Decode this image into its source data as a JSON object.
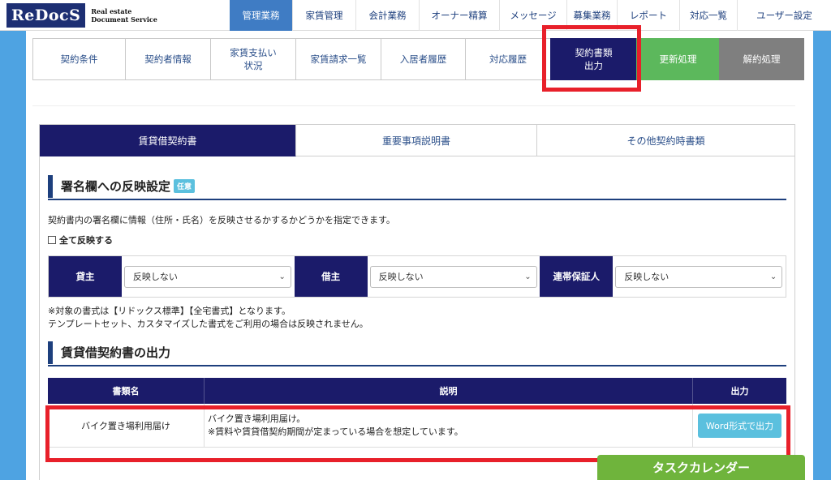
{
  "logo": {
    "main_prefix": "Re",
    "main_suffix": "DocS",
    "sub_line1": "Real estate",
    "sub_line2": "Document Service"
  },
  "nav": [
    "管理業務",
    "家賃管理",
    "会計業務",
    "オーナー精算",
    "メッセージ",
    "募集業務",
    "レポート",
    "対応一覧",
    "ユーザー設定"
  ],
  "subtabs": [
    {
      "label": "契約条件"
    },
    {
      "label": "契約者情報"
    },
    {
      "label": "家賃支払い\n状況"
    },
    {
      "label": "家賃請求一覧"
    },
    {
      "label": "入居者履歴"
    },
    {
      "label": "対応履歴"
    },
    {
      "label": "契約書類\n出力"
    },
    {
      "label": "更新処理"
    },
    {
      "label": "解約処理"
    }
  ],
  "doctabs": [
    "賃貸借契約書",
    "重要事項説明書",
    "その他契約時書類"
  ],
  "sign_section": {
    "title": "署名欄への反映設定",
    "badge": "任意",
    "description": "契約書内の署名欄に情報（住所・氏名）を反映させるかするかどうかを指定できます。",
    "all_reflect": "全て反映する",
    "parties": [
      {
        "label": "貸主",
        "value": "反映しない"
      },
      {
        "label": "借主",
        "value": "反映しない"
      },
      {
        "label": "連帯保証人",
        "value": "反映しない"
      }
    ],
    "note1": "※対象の書式は【リドックス標準】【全宅書式】となります。",
    "note2": "テンプレートセット、カスタマイズした書式をご利用の場合は反映されません。"
  },
  "output_section": {
    "title": "賃貸借契約書の出力",
    "headers": [
      "書類名",
      "説明",
      "出力"
    ],
    "rows": [
      {
        "name": "バイク置き場利用届け",
        "desc1": "バイク置き場利用届け。",
        "desc2": "※賃料や賃貸借契約期間が定まっている場合を想定しています。",
        "button": "Word形式で出力"
      }
    ]
  },
  "task_calendar": "タスクカレンダー",
  "colors": {
    "navy": "#1b1b6a",
    "highlight": "#e8202a",
    "accent_blue": "#5bc0de",
    "green": "#5cb85c"
  }
}
